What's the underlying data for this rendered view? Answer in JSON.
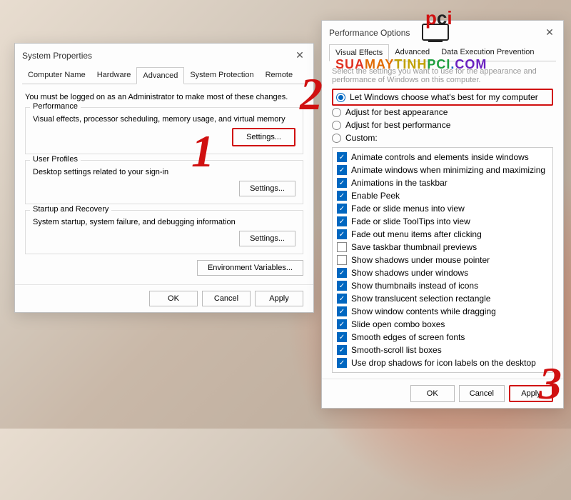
{
  "annotations": {
    "step1": "1",
    "step2": "2",
    "step3": "3",
    "url": "SUAMAYTINHPCI.COM",
    "logo": "pci"
  },
  "sysprops": {
    "title": "System Properties",
    "tabs": [
      "Computer Name",
      "Hardware",
      "Advanced",
      "System Protection",
      "Remote"
    ],
    "active_tab": 2,
    "note": "You must be logged on as an Administrator to make most of these changes.",
    "perf": {
      "legend": "Performance",
      "desc": "Visual effects, processor scheduling, memory usage, and virtual memory",
      "button": "Settings..."
    },
    "profiles": {
      "legend": "User Profiles",
      "desc": "Desktop settings related to your sign-in",
      "button": "Settings..."
    },
    "startup": {
      "legend": "Startup and Recovery",
      "desc": "System startup, system failure, and debugging information",
      "button": "Settings..."
    },
    "envvars": "Environment Variables...",
    "ok": "OK",
    "cancel": "Cancel",
    "apply": "Apply"
  },
  "perfopts": {
    "title": "Performance Options",
    "tabs": [
      "Visual Effects",
      "Advanced",
      "Data Execution Prevention"
    ],
    "active_tab": 0,
    "desc": "Select the settings you want to use for the appearance and performance of Windows on this computer.",
    "radios": [
      {
        "label": "Let Windows choose what's best for my computer",
        "checked": true
      },
      {
        "label": "Adjust for best appearance",
        "checked": false
      },
      {
        "label": "Adjust for best performance",
        "checked": false
      },
      {
        "label": "Custom:",
        "checked": false
      }
    ],
    "checks": [
      {
        "label": "Animate controls and elements inside windows",
        "checked": true
      },
      {
        "label": "Animate windows when minimizing and maximizing",
        "checked": true
      },
      {
        "label": "Animations in the taskbar",
        "checked": true
      },
      {
        "label": "Enable Peek",
        "checked": true
      },
      {
        "label": "Fade or slide menus into view",
        "checked": true
      },
      {
        "label": "Fade or slide ToolTips into view",
        "checked": true
      },
      {
        "label": "Fade out menu items after clicking",
        "checked": true
      },
      {
        "label": "Save taskbar thumbnail previews",
        "checked": false
      },
      {
        "label": "Show shadows under mouse pointer",
        "checked": false
      },
      {
        "label": "Show shadows under windows",
        "checked": true
      },
      {
        "label": "Show thumbnails instead of icons",
        "checked": true
      },
      {
        "label": "Show translucent selection rectangle",
        "checked": true
      },
      {
        "label": "Show window contents while dragging",
        "checked": true
      },
      {
        "label": "Slide open combo boxes",
        "checked": true
      },
      {
        "label": "Smooth edges of screen fonts",
        "checked": true
      },
      {
        "label": "Smooth-scroll list boxes",
        "checked": true
      },
      {
        "label": "Use drop shadows for icon labels on the desktop",
        "checked": true
      }
    ],
    "ok": "OK",
    "cancel": "Cancel",
    "apply": "Apply"
  }
}
